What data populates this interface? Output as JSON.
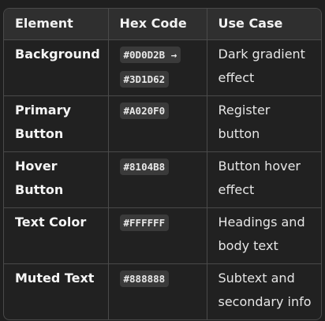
{
  "table": {
    "headers": [
      "Element",
      "Hex Code",
      "Use Case"
    ],
    "rows": [
      {
        "element": "Background",
        "hex": "#0D0D2B → #3D1D62",
        "use_case": "Dark gradient effect"
      },
      {
        "element": "Primary Button",
        "hex": "#A020F0",
        "use_case": "Register button"
      },
      {
        "element": "Hover Button",
        "hex": "#8104B8",
        "use_case": "Button hover effect"
      },
      {
        "element": "Text Color",
        "hex": "#FFFFFF",
        "use_case": "Headings and body text"
      },
      {
        "element": "Muted Text",
        "hex": "#888888",
        "use_case": "Subtext and secondary info"
      }
    ]
  },
  "colors": {
    "page_background": "#1f1f1f",
    "header_background": "#2f2f2f",
    "border": "#4a4a4a",
    "code_background": "#3a3a3a",
    "text": "#ececec"
  }
}
